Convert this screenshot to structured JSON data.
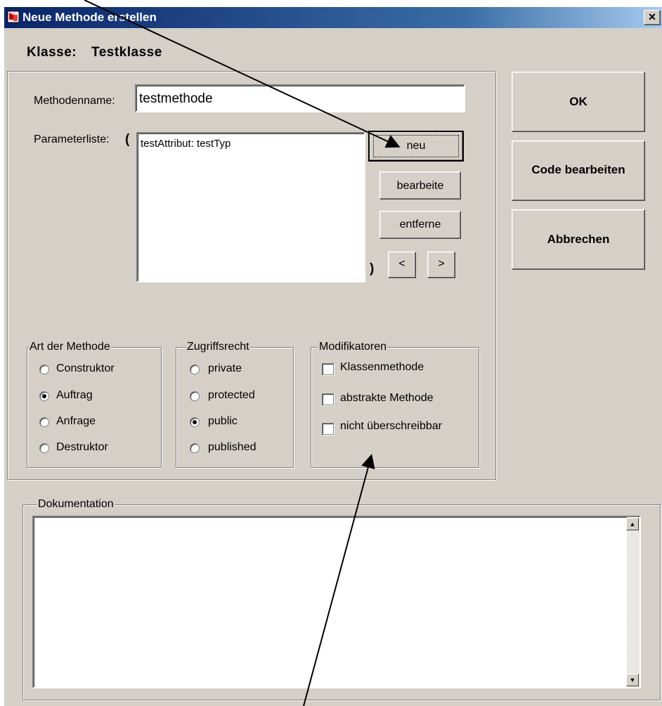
{
  "window": {
    "title": "Neue Methode erstellen",
    "close_label": "×"
  },
  "klasse": {
    "label": "Klasse:",
    "name": "Testklasse"
  },
  "methodenname": {
    "label": "Methodenname:",
    "value": "testmethode"
  },
  "parameterliste": {
    "label": "Parameterliste:",
    "open_paren": "(",
    "close_paren": ")",
    "items": [
      "testAttribut: testTyp"
    ]
  },
  "param_buttons": {
    "neu": "neu",
    "bearbeite": "bearbeite",
    "entferne": "entferne",
    "left": "<",
    "right": ">"
  },
  "actions": {
    "ok": "OK",
    "code_bearbeiten": "Code bearbeiten",
    "abbrechen": "Abbrechen"
  },
  "art_der_methode": {
    "legend": "Art der Methode",
    "options": [
      "Construktor",
      "Auftrag",
      "Anfrage",
      "Destruktor"
    ],
    "selected": "Auftrag"
  },
  "zugriffsrecht": {
    "legend": "Zugriffsrecht",
    "options": [
      "private",
      "protected",
      "public",
      "published"
    ],
    "selected": "public"
  },
  "modifikatoren": {
    "legend": "Modifikatoren",
    "options": [
      "Klassenmethode",
      "abstrakte Methode",
      "nicht überschreibbar"
    ],
    "checked": [
      false,
      false,
      false
    ]
  },
  "dokumentation": {
    "legend": "Dokumentation",
    "value": ""
  },
  "colors": {
    "face": "#d4d0c8",
    "titlebar_start": "#0a246a",
    "titlebar_end": "#a6caf0",
    "field": "#ffffff"
  }
}
